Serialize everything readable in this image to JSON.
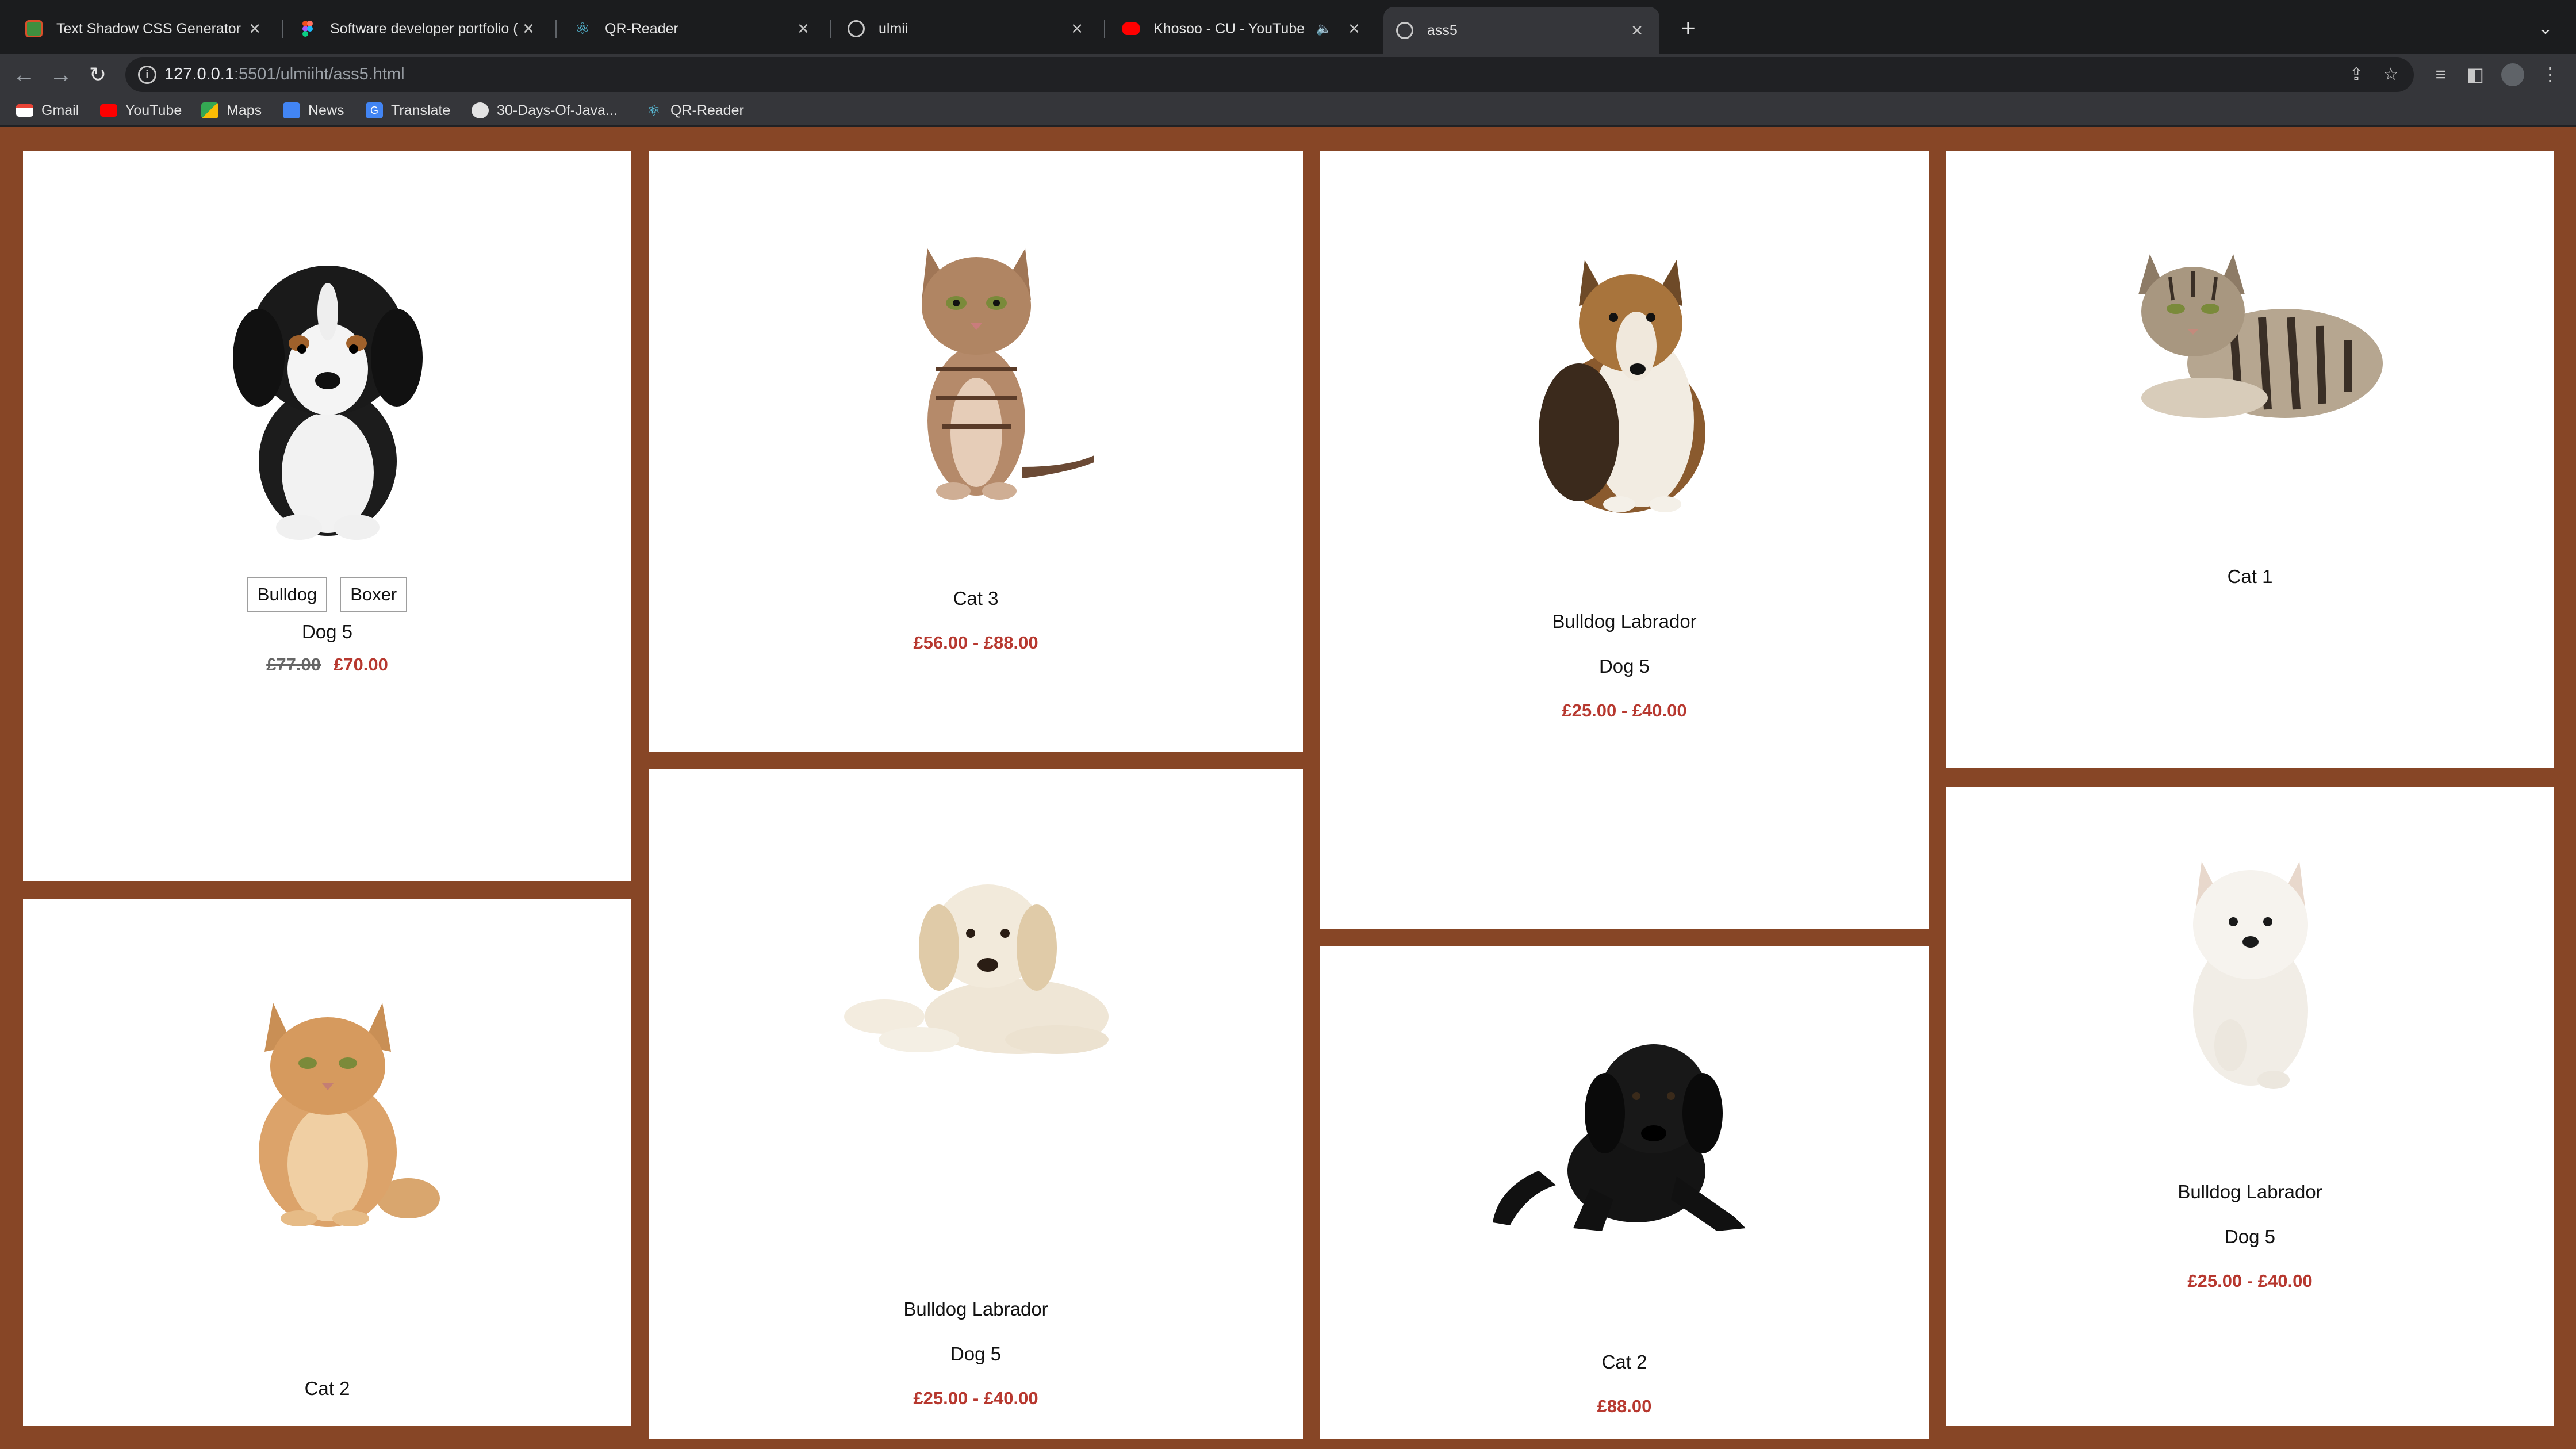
{
  "browser": {
    "tabs": [
      {
        "title": "Text Shadow CSS Generator",
        "favicon": "green-square-icon"
      },
      {
        "title": "Software developer portfolio (C",
        "favicon": "figma-icon"
      },
      {
        "title": "QR-Reader",
        "favicon": "react-icon"
      },
      {
        "title": "ulmii",
        "favicon": "globe-icon"
      },
      {
        "title": "Khosoo - CU - YouTube",
        "favicon": "youtube-icon",
        "audio": "speaker-icon"
      },
      {
        "title": "ass5",
        "favicon": "globe-icon",
        "active": true
      }
    ],
    "url_host": "127.0.0.1",
    "url_rest": ":5501/ulmiiht/ass5.html",
    "bookmarks": [
      {
        "label": "Gmail",
        "icon": "gmail-icon"
      },
      {
        "label": "YouTube",
        "icon": "youtube-icon"
      },
      {
        "label": "Maps",
        "icon": "maps-icon"
      },
      {
        "label": "News",
        "icon": "news-icon"
      },
      {
        "label": "Translate",
        "icon": "translate-icon"
      },
      {
        "label": "30-Days-Of-Java...",
        "icon": "github-icon"
      },
      {
        "label": "QR-Reader",
        "icon": "react-icon"
      }
    ]
  },
  "colors": {
    "page_background": "#874626",
    "card_background": "#ffffff",
    "price": "#b7382f"
  },
  "cards": [
    {
      "pet": "dog-5-puppy",
      "options": [
        "Bulldog",
        "Boxer"
      ],
      "name": "Dog 5",
      "old_price": "£77.00",
      "price": "£70.00"
    },
    {
      "pet": "cat-3-kitten",
      "name": "Cat 3",
      "price": "£56.00 - £88.00"
    },
    {
      "pet": "collie-dog",
      "breed": "Bulldog Labrador",
      "name": "Dog 5",
      "price": "£25.00 - £40.00"
    },
    {
      "pet": "tabby-cat-lying",
      "name": "Cat 1"
    },
    {
      "pet": "ginger-cat",
      "name": "Cat 2"
    },
    {
      "pet": "golden-puppy-lying",
      "breed": "Bulldog Labrador",
      "name": "Dog 5",
      "price": "£25.00 - £40.00"
    },
    {
      "pet": "black-labrador-puppy",
      "name": "Cat 2",
      "price": "£88.00"
    },
    {
      "pet": "white-fluffy-puppy",
      "breed": "Bulldog Labrador",
      "name": "Dog 5",
      "price": "£25.00 - £40.00"
    }
  ]
}
